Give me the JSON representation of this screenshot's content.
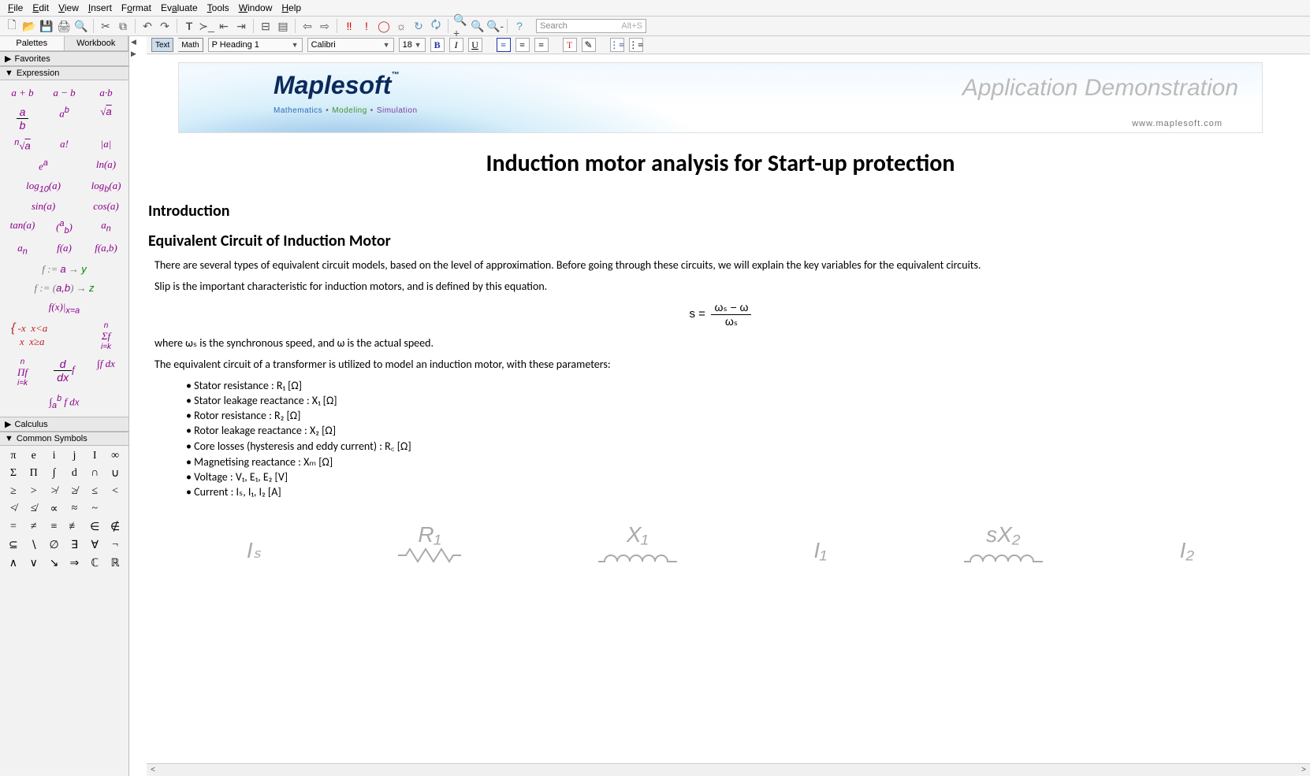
{
  "menu": {
    "file": "File",
    "edit": "Edit",
    "view": "View",
    "insert": "Insert",
    "format": "Format",
    "evaluate": "Evaluate",
    "tools": "Tools",
    "window": "Window",
    "help": "Help"
  },
  "search": {
    "placeholder": "Search",
    "shortcut": "Alt+S"
  },
  "fmt": {
    "text": "Text",
    "math": "Math",
    "para": "P Heading 1",
    "font": "Calibri",
    "size": "18"
  },
  "palette": {
    "tab1": "Palettes",
    "tab2": "Workbook"
  },
  "sections": {
    "fav": "Favorites",
    "expr": "Expression",
    "calc": "Calculus",
    "sym": "Common Symbols"
  },
  "expr": [
    "a + b",
    "a − b",
    "a·b",
    "a/b",
    "aᵇ",
    "√a",
    "ⁿ√a",
    "a!",
    "|a|",
    "eᵃ",
    "ln(a)",
    "log₁₀(a)",
    "log_b(a)",
    "sin(a)",
    "cos(a)",
    "tan(a)",
    "(a b)",
    "aₙ",
    "aₙ",
    "f(a)",
    "f(a,b)",
    "f := a → y",
    "f := (a,b) → z",
    "f(x)|",
    "|x=a",
    "{-x x<a; x x≥a}",
    "Σf",
    "Πf",
    "d/dx f",
    "∫f dx",
    "∫ₐᵇ f dx"
  ],
  "syms": [
    "π",
    "e",
    "i",
    "j",
    "I",
    "∞",
    "Σ",
    "Π",
    "∫",
    "d",
    "∩",
    "∪",
    "≥",
    ">",
    "≯",
    "≱",
    "≤",
    "<",
    "≮",
    "≰",
    "∝",
    "≈",
    "~",
    " ",
    "=",
    "≠",
    "≡",
    "≢",
    "∈",
    "∉",
    "⊆",
    "∖",
    "∅",
    "∃",
    "∀",
    "¬",
    "∧",
    "∨",
    "↘",
    "⇒",
    "ℂ",
    "ℝ"
  ],
  "banner": {
    "logo": "Maplesoft",
    "tag1": "Mathematics",
    "tag2": "Modeling",
    "tag3": "Simulation",
    "title": "Application Demonstration",
    "site": "www.maplesoft.com"
  },
  "doc": {
    "title": "Induction motor analysis for Start-up protection",
    "s1": "Introduction",
    "s2": "Equivalent Circuit of Induction Motor",
    "p1": "There are several types of equivalent circuit models, based on the level of approximation. Before going through these circuits, we will explain the key variables for the equivalent circuits.",
    "p2": "Slip is the important characteristic for induction motors, and is defined by this equation.",
    "p3": "where ωₛ is the synchronous speed, and ω is the actual speed.",
    "p4": "The equivalent circuit of a transformer is utilized to model an induction motor, with these parameters:",
    "b1": "Stator resistance : R₁ [Ω]",
    "b2": "Stator leakage reactance : X₁ [Ω]",
    "b3": "Rotor resistance : R₂ [Ω]",
    "b4": "Rotor leakage reactance : X₂ [Ω]",
    "b5": "Core losses (hysteresis and eddy current) : R꜀ [Ω]",
    "b6": "Magnetising reactance : Xₘ [Ω]",
    "b7": "Voltage : V₁, E₁, E₂ [V]",
    "b8": "Current : Iₛ, I₁, I₂ [A]",
    "eq_lhs": "s =",
    "eq_num": "ωₛ − ω",
    "eq_den": "ωₛ",
    "c1": "Iₛ",
    "c2": "R₁",
    "c3": "X₁",
    "c4": "I₁",
    "c5": "sX₂",
    "c6": "I₂"
  }
}
